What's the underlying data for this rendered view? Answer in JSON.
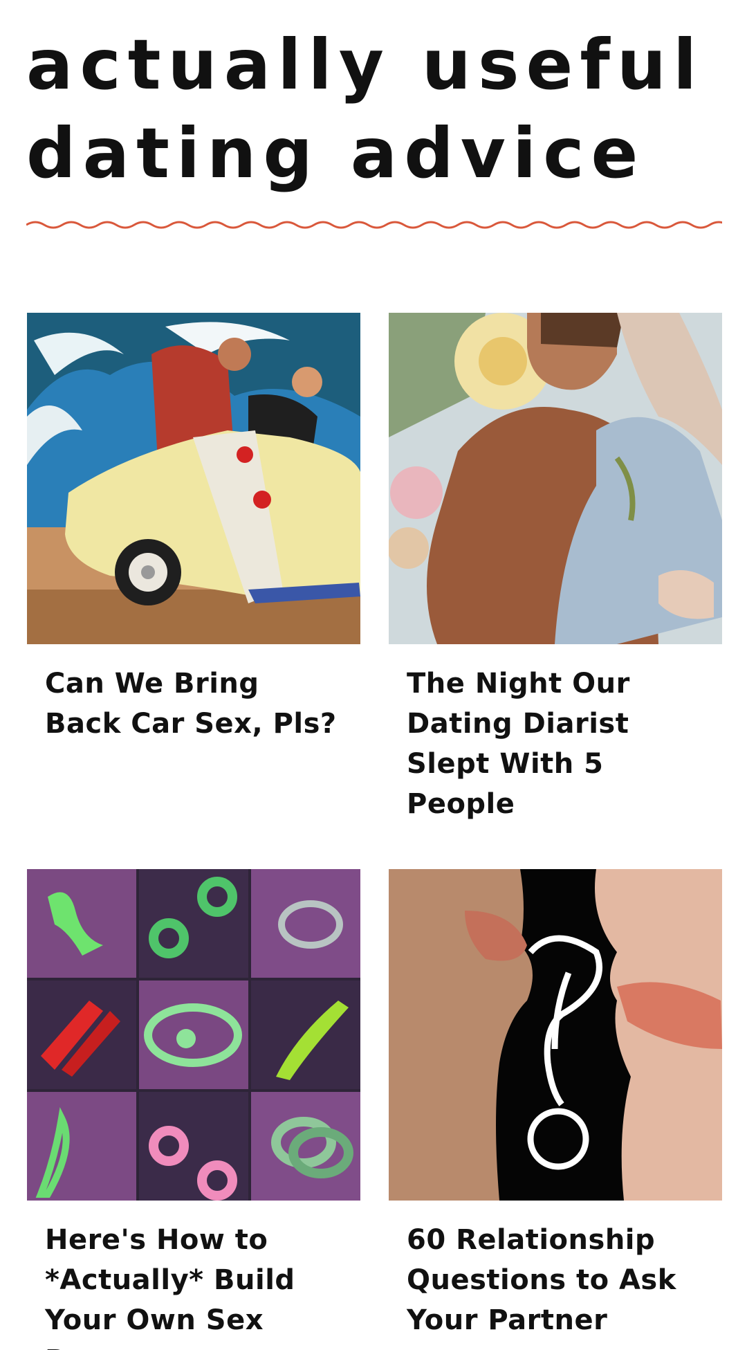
{
  "section": {
    "title_line_1": "actually useful",
    "title_line_2": "dating advice",
    "divider_color": "#d9583b"
  },
  "articles": [
    {
      "headline": "Can We Bring Back Car Sex, Pls?",
      "image": "retro-car-kiss-collage"
    },
    {
      "headline": "The Night Our Dating Diarist Slept With 5 People",
      "image": "floral-couple-collage"
    },
    {
      "headline": "Here's How to *Actually* Build Your Own Sex Room",
      "image": "sex-toys-grid"
    },
    {
      "headline": "60 Relationship Questions to Ask Your Partner",
      "image": "lips-question-mark"
    }
  ]
}
